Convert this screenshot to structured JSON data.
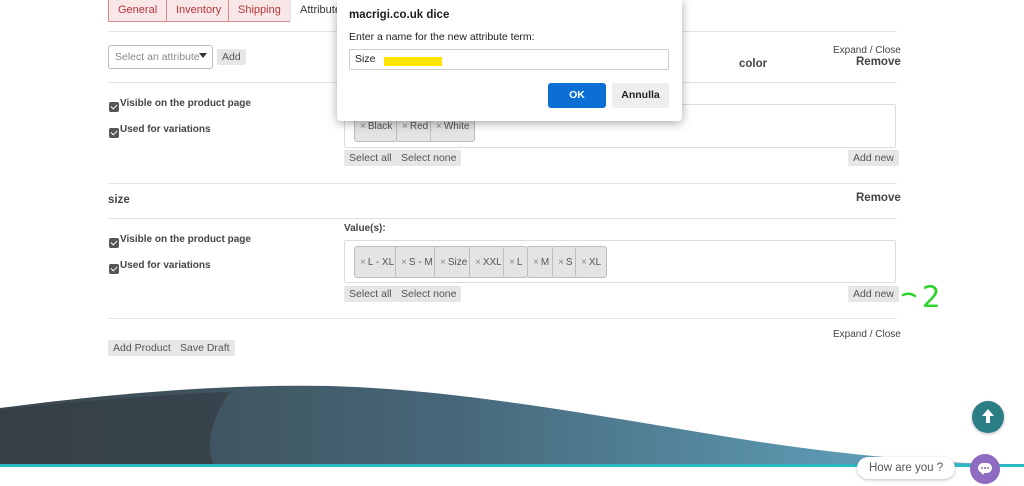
{
  "tabs": [
    "General",
    "Inventory",
    "Shipping",
    "Attributes"
  ],
  "attribute_select": {
    "placeholder": "Select an attribute",
    "add_label": "Add"
  },
  "expand_close": "Expand / Close",
  "remove_label": "Remove",
  "attributes": [
    {
      "name": "color",
      "visible_label": "Visible on the product page",
      "variations_label": "Used for variations",
      "values": [
        "Black",
        "Red",
        "White"
      ],
      "select_all": "Select all",
      "select_none": "Select none",
      "add_new": "Add new"
    },
    {
      "name": "size",
      "values_label": "Value(s):",
      "visible_label": "Visible on the product page",
      "variations_label": "Used for variations",
      "values": [
        "L - XL",
        "S - M",
        "Size",
        "XXL",
        "L",
        "M",
        "S",
        "XL"
      ],
      "select_all": "Select all",
      "select_none": "Select none",
      "add_new": "Add new"
    }
  ],
  "footer_buttons": {
    "add_product": "Add Product",
    "save_draft": "Save Draft"
  },
  "dialog": {
    "title": "macrigi.co.uk dice",
    "message": "Enter a name for the new attribute term:",
    "input_value": "Size",
    "ok": "OK",
    "cancel": "Annulla"
  },
  "annotation": "2",
  "chat": {
    "prompt": "How are you ?"
  },
  "colors": {
    "tab_accent": "#b2373d",
    "wave_dark": "#3d4a50",
    "wave_light": "#5aa2c0",
    "teal_line": "#2ab8c4",
    "ok_button": "#0b6fd4",
    "chat_button": "#8e6ac0",
    "annotation": "#2bd42b"
  }
}
